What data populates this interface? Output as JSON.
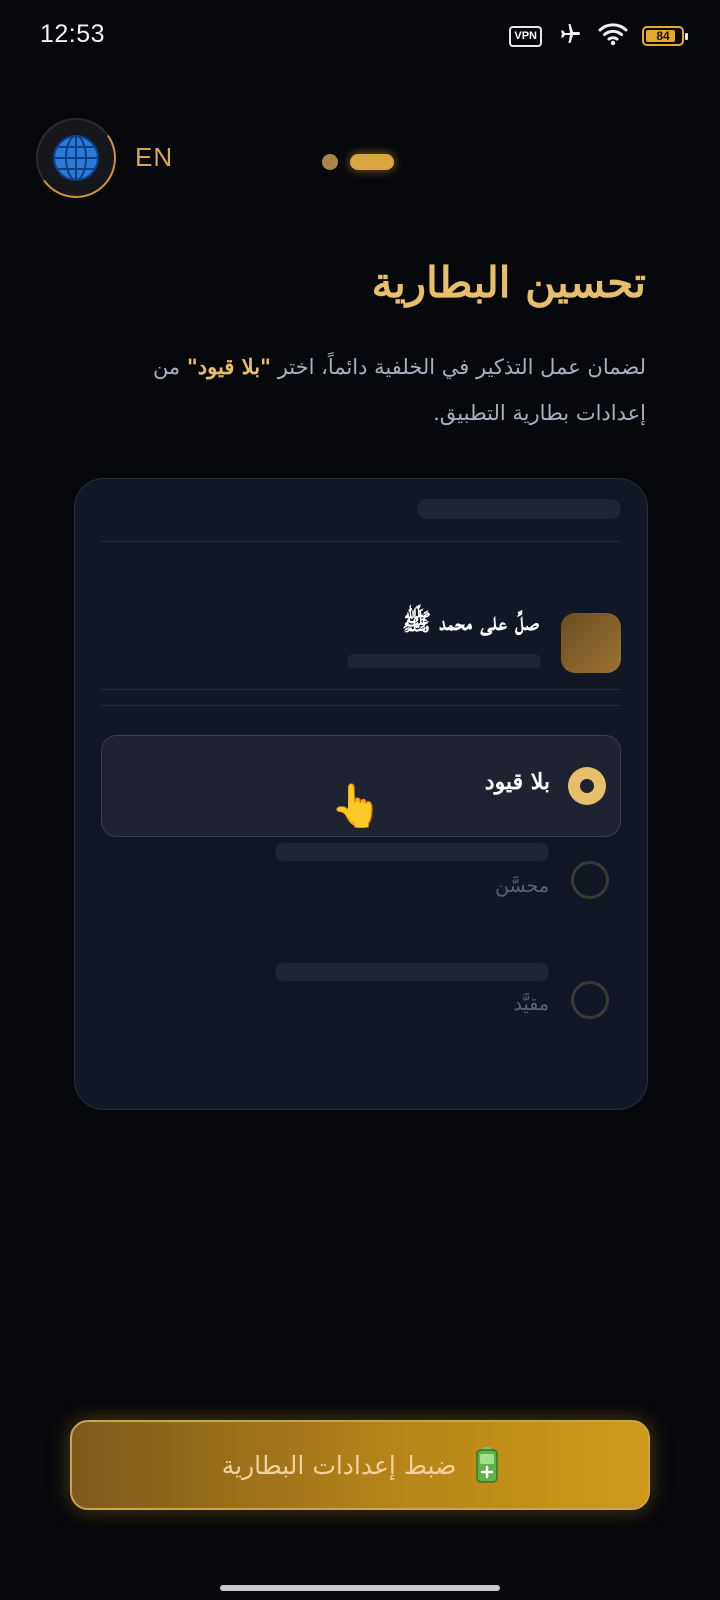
{
  "status_bar": {
    "time": "12:53",
    "vpn_label": "VPN",
    "battery_level": "84",
    "battery_fraction": 0.84
  },
  "header": {
    "language_code": "EN",
    "pager": {
      "pages": 2,
      "active_index": 1
    }
  },
  "main": {
    "title": "تحسين البطارية",
    "subtitle_part1": "لضمان عمل التذكير في الخلفية دائماً، اختر ",
    "subtitle_highlight": "\"بلا قيود\"",
    "subtitle_part2": " من إعدادات بطارية التطبيق."
  },
  "illustration_card": {
    "app_name": "صلِّ على محمد ﷺ",
    "options": [
      {
        "label": "بلا قيود",
        "selected": true
      },
      {
        "label": "محسَّن",
        "selected": false
      },
      {
        "label": "مقيَّد",
        "selected": false
      }
    ],
    "pointer_icon": "👆"
  },
  "footer": {
    "button_label": "ضبط إعدادات البطارية",
    "button_icon": "battery-icon"
  },
  "colors": {
    "background": "#07080b",
    "accent_gold": "#e7bf6c",
    "card_bg": "#121726",
    "button_gradient_start": "#7c5a1c",
    "button_gradient_end": "#d09a18"
  }
}
